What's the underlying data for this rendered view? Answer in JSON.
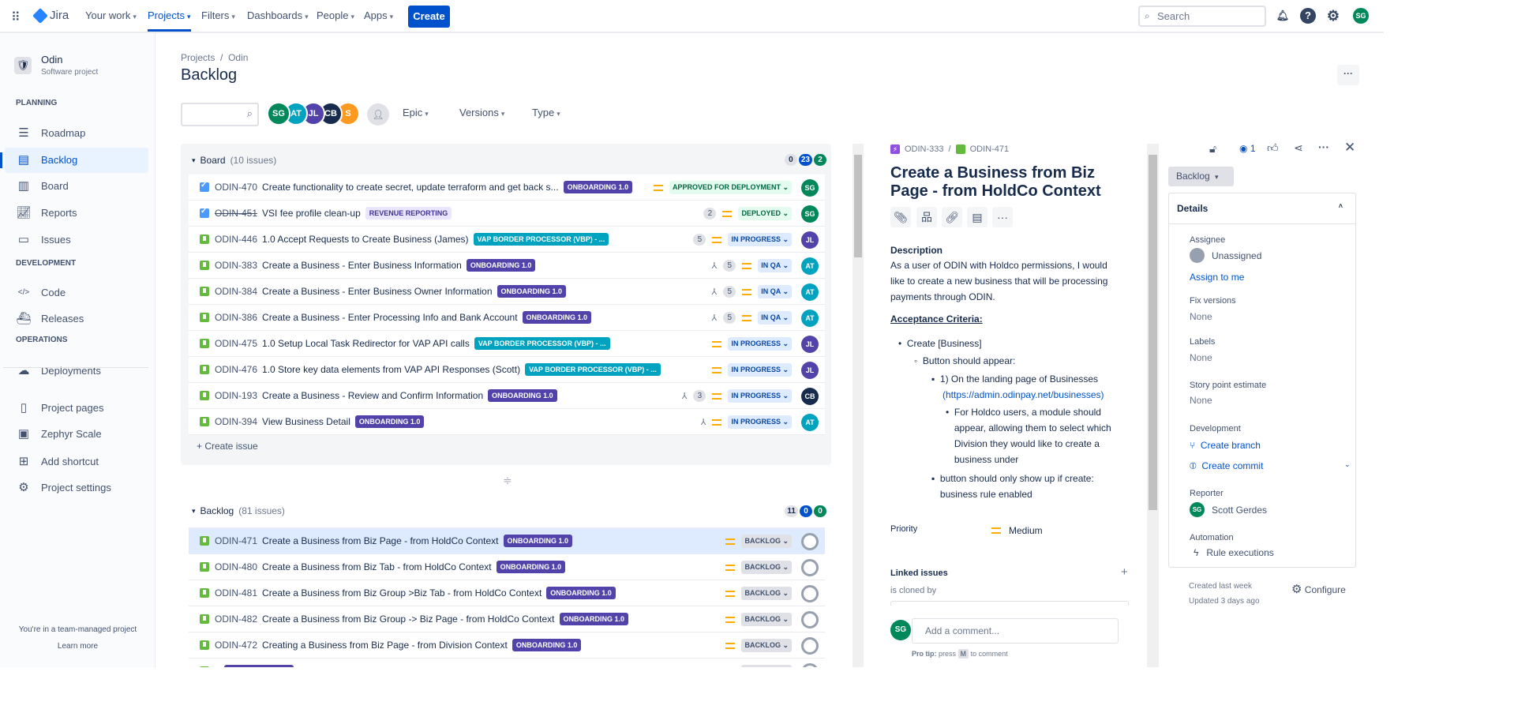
{
  "topbar": {
    "product": "Jira",
    "nav": [
      {
        "label": "Your work",
        "active": false
      },
      {
        "label": "Projects",
        "active": true
      },
      {
        "label": "Filters",
        "active": false
      },
      {
        "label": "Dashboards",
        "active": false
      },
      {
        "label": "People",
        "active": false
      },
      {
        "label": "Apps",
        "active": false
      }
    ],
    "create": "Create",
    "search_placeholder": "Search",
    "user_initials": "SG"
  },
  "sidebar": {
    "project_name": "Odin",
    "project_type": "Software project",
    "sections": [
      {
        "heading": "PLANNING",
        "items": [
          {
            "label": "Roadmap",
            "icon": "roadmap-icon"
          },
          {
            "label": "Backlog",
            "icon": "backlog-icon",
            "active": true
          },
          {
            "label": "Board",
            "icon": "board-icon"
          },
          {
            "label": "Reports",
            "icon": "reports-icon"
          },
          {
            "label": "Issues",
            "icon": "issues-icon"
          }
        ]
      },
      {
        "heading": "DEVELOPMENT",
        "items": [
          {
            "label": "Code",
            "icon": "code-icon"
          },
          {
            "label": "Releases",
            "icon": "releases-icon"
          }
        ]
      },
      {
        "heading": "OPERATIONS",
        "items": [
          {
            "label": "Deployments",
            "icon": "deployments-icon"
          }
        ]
      },
      {
        "heading": "",
        "items": [
          {
            "label": "Project pages",
            "icon": "pages-icon"
          },
          {
            "label": "Zephyr Scale",
            "icon": "zephyr-icon"
          },
          {
            "label": "Add shortcut",
            "icon": "add-shortcut-icon"
          },
          {
            "label": "Project settings",
            "icon": "gear-icon"
          }
        ]
      }
    ],
    "footer": "You're in a team-managed project",
    "learn_more": "Learn more"
  },
  "main": {
    "breadcrumb": [
      "Projects",
      "Odin"
    ],
    "title": "Backlog",
    "avatars": [
      {
        "i": "SG",
        "c": "#00875a"
      },
      {
        "i": "AT",
        "c": "#00a3bf"
      },
      {
        "i": "JL",
        "c": "#5243aa"
      },
      {
        "i": "CB",
        "c": "#172b4d"
      },
      {
        "i": "S",
        "c": "#ff991f"
      }
    ],
    "filters": [
      "Epic",
      "Versions",
      "Type"
    ]
  },
  "epic_colors": {
    "ONBOARDING 1.0": {
      "bg": "#5243aa",
      "fg": "#ffffff"
    },
    "VAP BORDER PROCESSOR (VBP) - ...": {
      "bg": "#00a3bf",
      "fg": "#ffffff"
    },
    "REVENUE REPORTING": {
      "bg": "#eae6ff",
      "fg": "#403294"
    }
  },
  "status_colors": {
    "APPROVED FOR DEPLOYMENT": {
      "bg": "#e3fcef",
      "fg": "#006644"
    },
    "DEPLOYED": {
      "bg": "#e3fcef",
      "fg": "#006644"
    },
    "IN PROGRESS": {
      "bg": "#deebff",
      "fg": "#0747a6"
    },
    "IN QA": {
      "bg": "#deebff",
      "fg": "#0747a6"
    },
    "BACKLOG": {
      "bg": "#dfe1e6",
      "fg": "#42526e"
    }
  },
  "avatar_colors": {
    "SG": "#00875a",
    "AT": "#00a3bf",
    "JL": "#5243aa",
    "CB": "#172b4d"
  },
  "board": {
    "name": "Board",
    "count": "(10 issues)",
    "counts": [
      "0",
      "23",
      "2"
    ],
    "create_issue": "+ Create issue",
    "issues": [
      {
        "type": "done",
        "key": "ODIN-470",
        "summary": "Create functionality to create secret, update terraform and get back s...",
        "epic": "ONBOARDING 1.0",
        "points": "",
        "child": false,
        "status": "APPROVED FOR DEPLOYMENT",
        "assignee": "SG"
      },
      {
        "type": "done",
        "key": "ODIN-451",
        "strike": true,
        "summary": "VSI fee profile clean-up",
        "epic": "REVENUE REPORTING",
        "points": "2",
        "child": false,
        "status": "DEPLOYED",
        "assignee": "SG"
      },
      {
        "type": "story",
        "key": "ODIN-446",
        "summary": "1.0 Accept Requests to Create Business (James)",
        "epic": "VAP BORDER PROCESSOR (VBP) - ...",
        "points": "5",
        "child": false,
        "status": "IN PROGRESS",
        "assignee": "JL"
      },
      {
        "type": "story",
        "key": "ODIN-383",
        "summary": "Create a Business - Enter Business Information",
        "epic": "ONBOARDING 1.0",
        "points": "5",
        "child": true,
        "status": "IN QA",
        "assignee": "AT"
      },
      {
        "type": "story",
        "key": "ODIN-384",
        "summary": "Create a Business - Enter Business Owner Information",
        "epic": "ONBOARDING 1.0",
        "points": "5",
        "child": true,
        "status": "IN QA",
        "assignee": "AT"
      },
      {
        "type": "story",
        "key": "ODIN-386",
        "summary": "Create a Business - Enter Processing Info and Bank Account",
        "epic": "ONBOARDING 1.0",
        "points": "5",
        "child": true,
        "status": "IN QA",
        "assignee": "AT"
      },
      {
        "type": "story",
        "key": "ODIN-475",
        "summary": "1.0 Setup Local Task Redirector for VAP API calls",
        "epic": "VAP BORDER PROCESSOR (VBP) - ...",
        "points": "",
        "child": false,
        "status": "IN PROGRESS",
        "assignee": "JL"
      },
      {
        "type": "story",
        "key": "ODIN-476",
        "summary": "1.0 Store key data elements from VAP API Responses (Scott)",
        "epic": "VAP BORDER PROCESSOR (VBP) - ...",
        "points": "",
        "child": false,
        "status": "IN PROGRESS",
        "assignee": "JL"
      },
      {
        "type": "story",
        "key": "ODIN-193",
        "summary": "Create a Business - Review and Confirm Information",
        "epic": "ONBOARDING 1.0",
        "points": "3",
        "child": true,
        "status": "IN PROGRESS",
        "assignee": "CB"
      },
      {
        "type": "story",
        "key": "ODIN-394",
        "summary": "View Business Detail",
        "epic": "ONBOARDING 1.0",
        "points": "",
        "child": true,
        "status": "IN PROGRESS",
        "assignee": "AT"
      }
    ]
  },
  "backlog": {
    "name": "Backlog",
    "count": "(81 issues)",
    "counts": [
      "11",
      "0",
      "0"
    ],
    "issues": [
      {
        "type": "story",
        "key": "ODIN-471",
        "summary": "Create a Business from Biz Page - from HoldCo Context",
        "epic": "ONBOARDING 1.0",
        "status": "BACKLOG",
        "selected": true
      },
      {
        "type": "story",
        "key": "ODIN-480",
        "summary": "Create a Business from Biz Tab - from HoldCo Context",
        "epic": "ONBOARDING 1.0",
        "status": "BACKLOG"
      },
      {
        "type": "story",
        "key": "ODIN-481",
        "summary": "Create a Business from Biz Group >Biz Tab - from HoldCo Context",
        "epic": "ONBOARDING 1.0",
        "status": "BACKLOG"
      },
      {
        "type": "story",
        "key": "ODIN-482",
        "summary": "Create a Business from Biz Group -> Biz Page - from HoldCo Context",
        "epic": "ONBOARDING 1.0",
        "status": "BACKLOG"
      },
      {
        "type": "story",
        "key": "ODIN-472",
        "summary": "Creating a Business from Biz Page - from Division Context",
        "epic": "ONBOARDING 1.0",
        "status": "BACKLOG"
      }
    ]
  },
  "detail": {
    "parent_key": "ODIN-333",
    "key": "ODIN-471",
    "title": "Create a Business from Biz Page - from HoldCo Context",
    "description_label": "Description",
    "description": "As a user of ODIN with Holdco permissions, I would like to create a new business that will be processing payments through ODIN.",
    "acceptance": "Acceptance Criteria:",
    "l1": "Create [Business]",
    "l2": "Button should appear:",
    "l3a": "1) On the landing page of Businesses",
    "l3a_link": "(https://admin.odinpay.net/businesses)",
    "l4": "For Holdco users, a module should appear, allowing them to select which Division they would like to create a business under",
    "l3b": "button should only show up if create: business rule enabled",
    "priority_label": "Priority",
    "priority": "Medium",
    "linked_label": "Linked issues",
    "linked_rel": "is cloned by",
    "comment_placeholder": "Add a comment...",
    "pro_tip": "Pro tip:",
    "press": "press",
    "key_m": "M",
    "to_comment": "to comment",
    "commenter": "SG"
  },
  "side": {
    "watchers": "1",
    "status_btn": "Backlog",
    "details": "Details",
    "assignee_label": "Assignee",
    "assignee": "Unassigned",
    "assign_me": "Assign to me",
    "fix_label": "Fix versions",
    "fix": "None",
    "labels_label": "Labels",
    "labels": "None",
    "sp_label": "Story point estimate",
    "sp": "None",
    "dev_label": "Development",
    "branch": "Create branch",
    "commit": "Create commit",
    "reporter_label": "Reporter",
    "reporter": "Scott Gerdes",
    "reporter_initials": "SG",
    "automation_label": "Automation",
    "rule": "Rule executions",
    "created": "Created last week",
    "updated": "Updated 3 days ago",
    "configure": "Configure"
  }
}
